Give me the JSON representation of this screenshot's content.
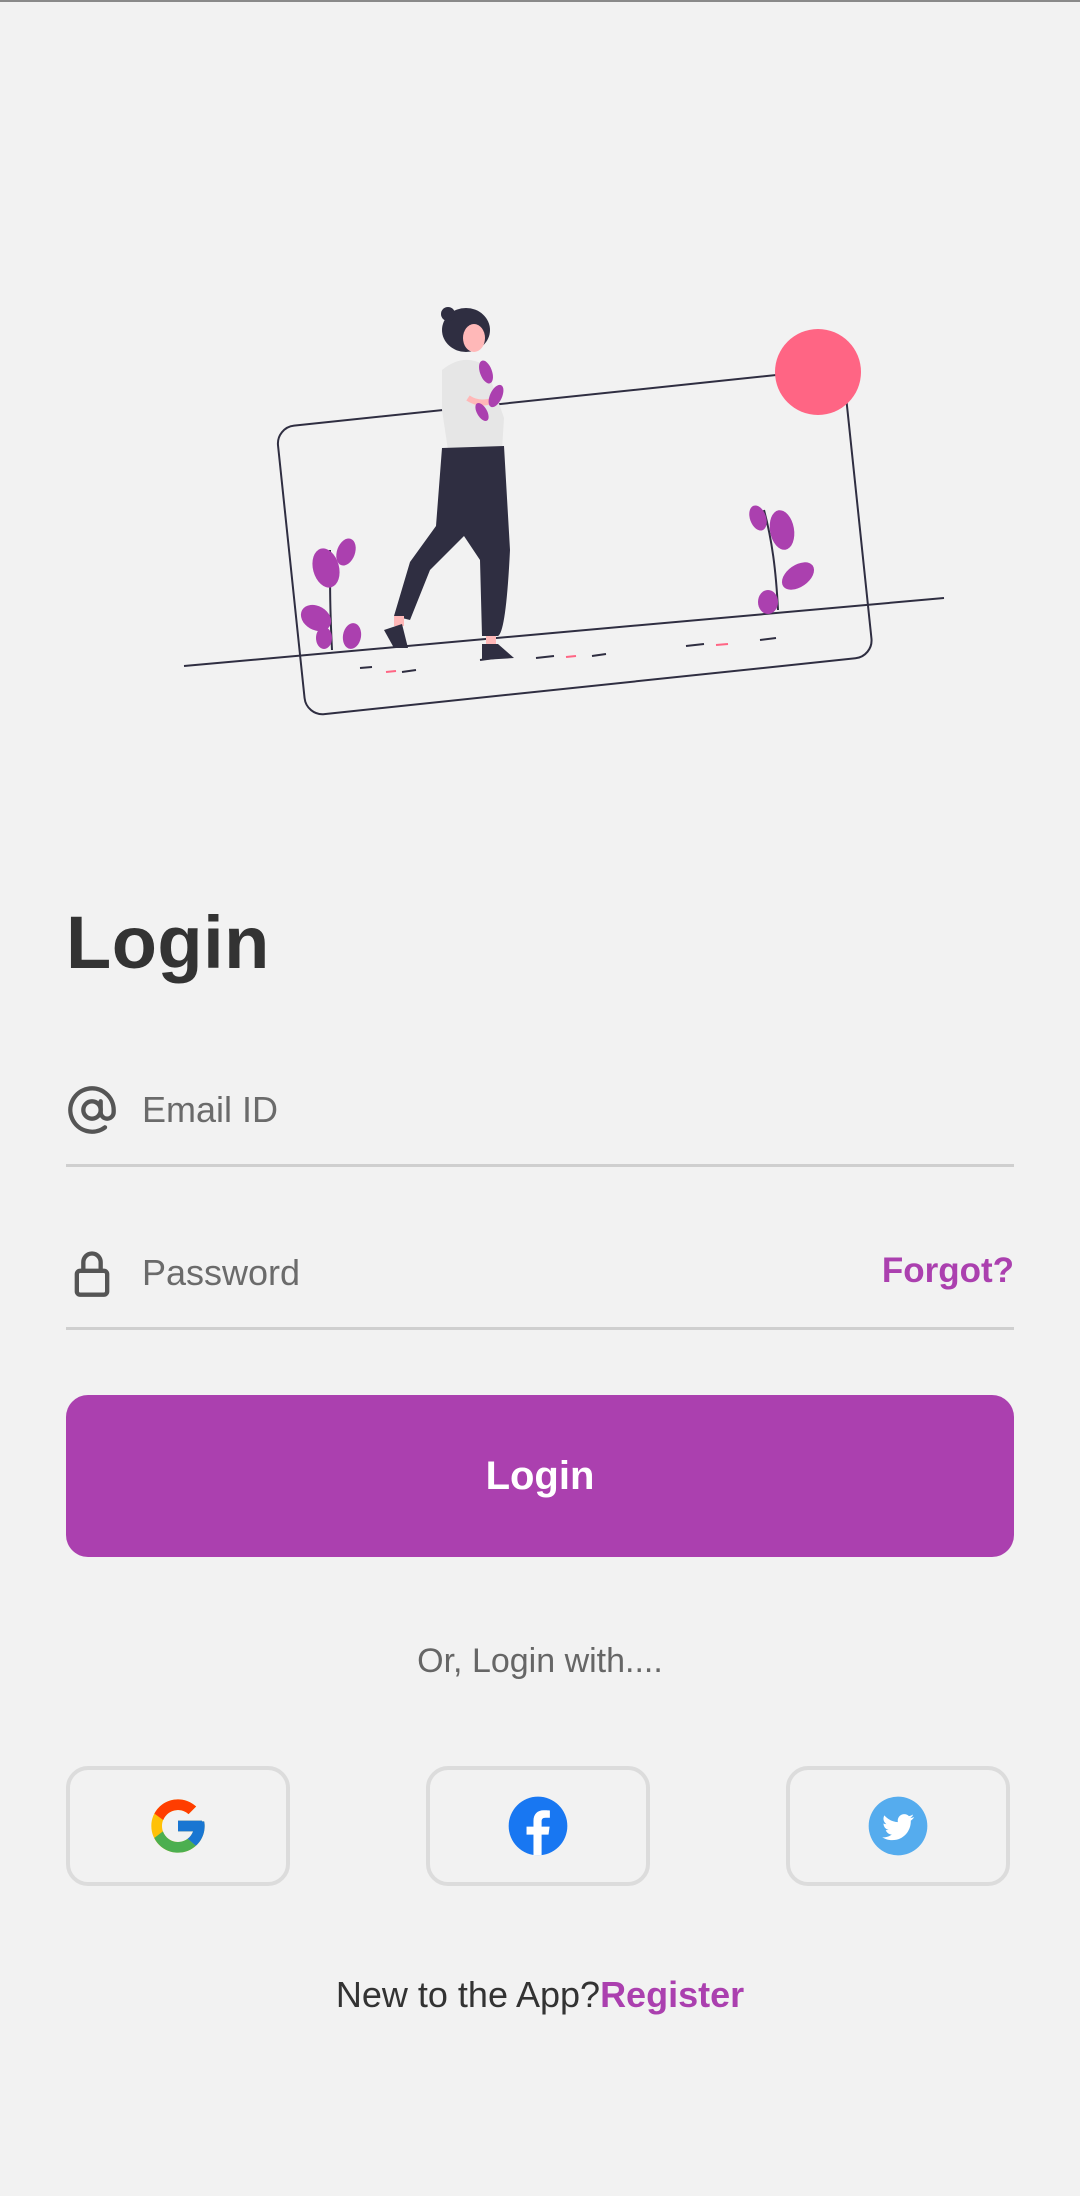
{
  "colors": {
    "background": "#f2f2f2",
    "accent": "#ab40af",
    "sun": "#ff6584",
    "figure_dark": "#2f2e41",
    "divider": "#cfcfcf"
  },
  "login": {
    "title": "Login"
  },
  "email_field": {
    "icon": "at-sign-icon",
    "placeholder": "Email ID",
    "value": ""
  },
  "password_field": {
    "icon": "lock-icon",
    "placeholder": "Password",
    "value": "",
    "forgot_label": "Forgot?"
  },
  "login_button": {
    "label": "Login"
  },
  "alt_login": {
    "text": "Or, Login with....",
    "providers": [
      {
        "name": "Google",
        "icon": "google-icon"
      },
      {
        "name": "Facebook",
        "icon": "facebook-icon"
      },
      {
        "name": "Twitter",
        "icon": "twitter-icon"
      }
    ]
  },
  "register": {
    "prompt": "New to the App?",
    "link_label": "Register"
  }
}
